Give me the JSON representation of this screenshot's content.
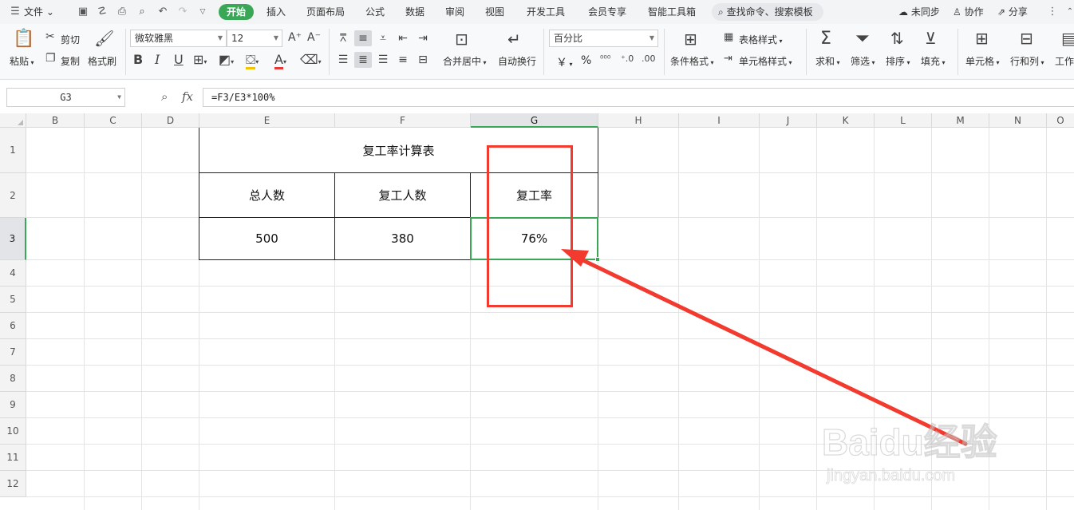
{
  "menu": {
    "file": "文件",
    "tabs": [
      "开始",
      "插入",
      "页面布局",
      "公式",
      "数据",
      "审阅",
      "视图",
      "开发工具",
      "会员专享",
      "智能工具箱"
    ],
    "search": "查找命令、搜索模板",
    "sync": "未同步",
    "collab": "协作",
    "share": "分享"
  },
  "ribbon": {
    "paste": "粘贴",
    "cut": "剪切",
    "copy": "复制",
    "format_painter": "格式刷",
    "font_name": "微软雅黑",
    "font_size": "12",
    "merge_center": "合并居中",
    "wrap_text": "自动换行",
    "number_format": "百分比",
    "currency": "￥",
    "percent": "%",
    "cond_format": "条件格式",
    "table_style": "表格样式",
    "cell_style": "单元格样式",
    "sum": "求和",
    "filter": "筛选",
    "sort": "排序",
    "fill": "填充",
    "cell": "单元格",
    "row_col": "行和列",
    "worksheet": "工作"
  },
  "formula_bar": {
    "name_box": "G3",
    "fx": "fx",
    "formula": "=F3/E3*100%"
  },
  "columns": [
    "B",
    "C",
    "D",
    "E",
    "F",
    "G",
    "H",
    "I",
    "J",
    "K",
    "L",
    "M",
    "N",
    "O"
  ],
  "rows": [
    "1",
    "2",
    "3",
    "4",
    "5",
    "6",
    "7",
    "8",
    "9",
    "10",
    "11",
    "12"
  ],
  "sheet": {
    "title": "复工率计算表",
    "headers": [
      "总人数",
      "复工人数",
      "复工率"
    ],
    "values": [
      "500",
      "380",
      "76%"
    ]
  },
  "colors": {
    "accent_green": "#3aa757",
    "annotation_red": "#f23a2e"
  },
  "watermark": {
    "text": "Baidu经验",
    "url": "jingyan.baidu.com"
  }
}
